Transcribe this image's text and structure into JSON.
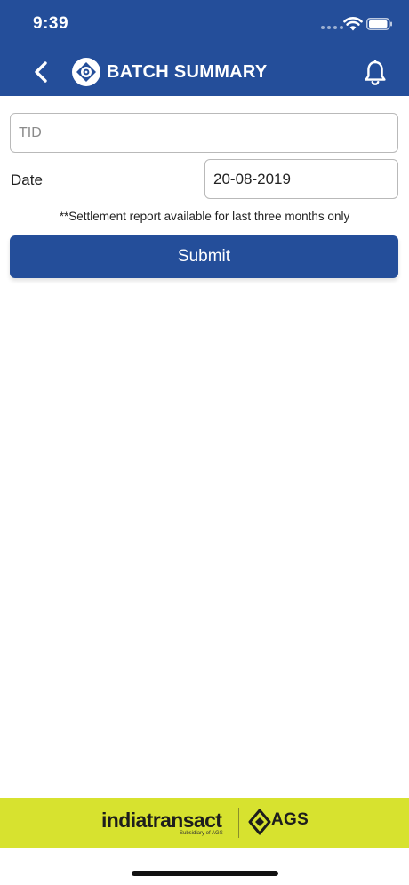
{
  "status_bar": {
    "time": "9:39"
  },
  "nav": {
    "title": "BATCH SUMMARY"
  },
  "form": {
    "tid_placeholder": "TID",
    "tid_value": "",
    "date_label": "Date",
    "date_value": "20-08-2019",
    "note": "**Settlement report available for last three months only",
    "submit_label": "Submit"
  },
  "footer": {
    "brand": "indiatransact",
    "brand_sub": "Subsidiary of AGS",
    "partner": "AGS"
  },
  "colors": {
    "primary": "#244e9a",
    "footer_bg": "#d7e22f"
  }
}
